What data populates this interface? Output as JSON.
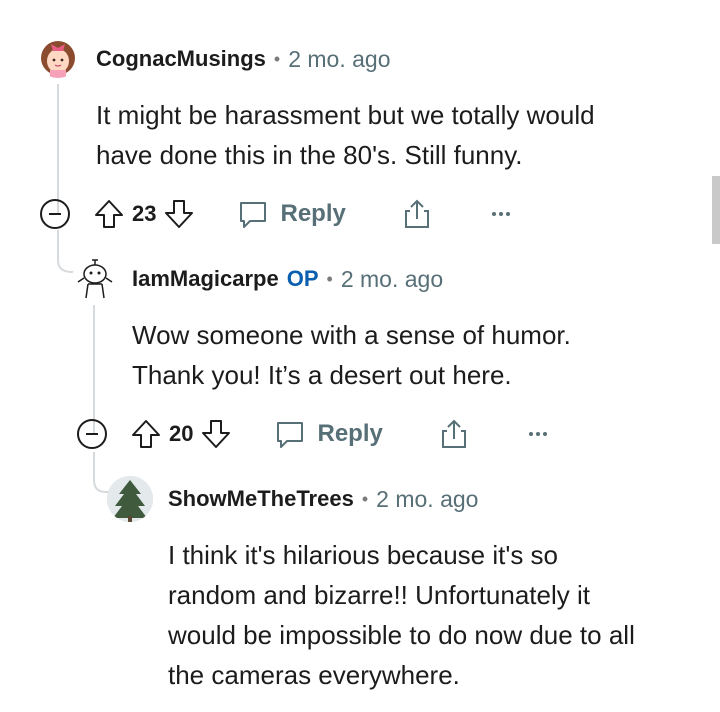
{
  "comments": [
    {
      "author": "CognacMusings",
      "op_badge": "",
      "age": "2 mo. ago",
      "text_lines": [
        "It might be harassment but we totally would",
        "have done this in the 80's. Still funny."
      ],
      "votes": "23",
      "reply_label": "Reply"
    },
    {
      "author": "IamMagicarpe",
      "op_badge": "OP",
      "age": "2 mo. ago",
      "text_lines": [
        "Wow someone with a sense of humor.",
        "Thank you! It’s a desert out here."
      ],
      "votes": "20",
      "reply_label": "Reply"
    },
    {
      "author": "ShowMeTheTrees",
      "op_badge": "",
      "age": "2 mo. ago",
      "text_lines": [
        "I think it's hilarious because it's so",
        "random and bizarre!! Unfortunately it",
        "would be impossible to do now due to all",
        "the cameras everywhere."
      ]
    }
  ],
  "separator": "•",
  "colors": {
    "op": "#0b5fae",
    "meta": "#576f76",
    "thread_line": "#d7dadc"
  }
}
